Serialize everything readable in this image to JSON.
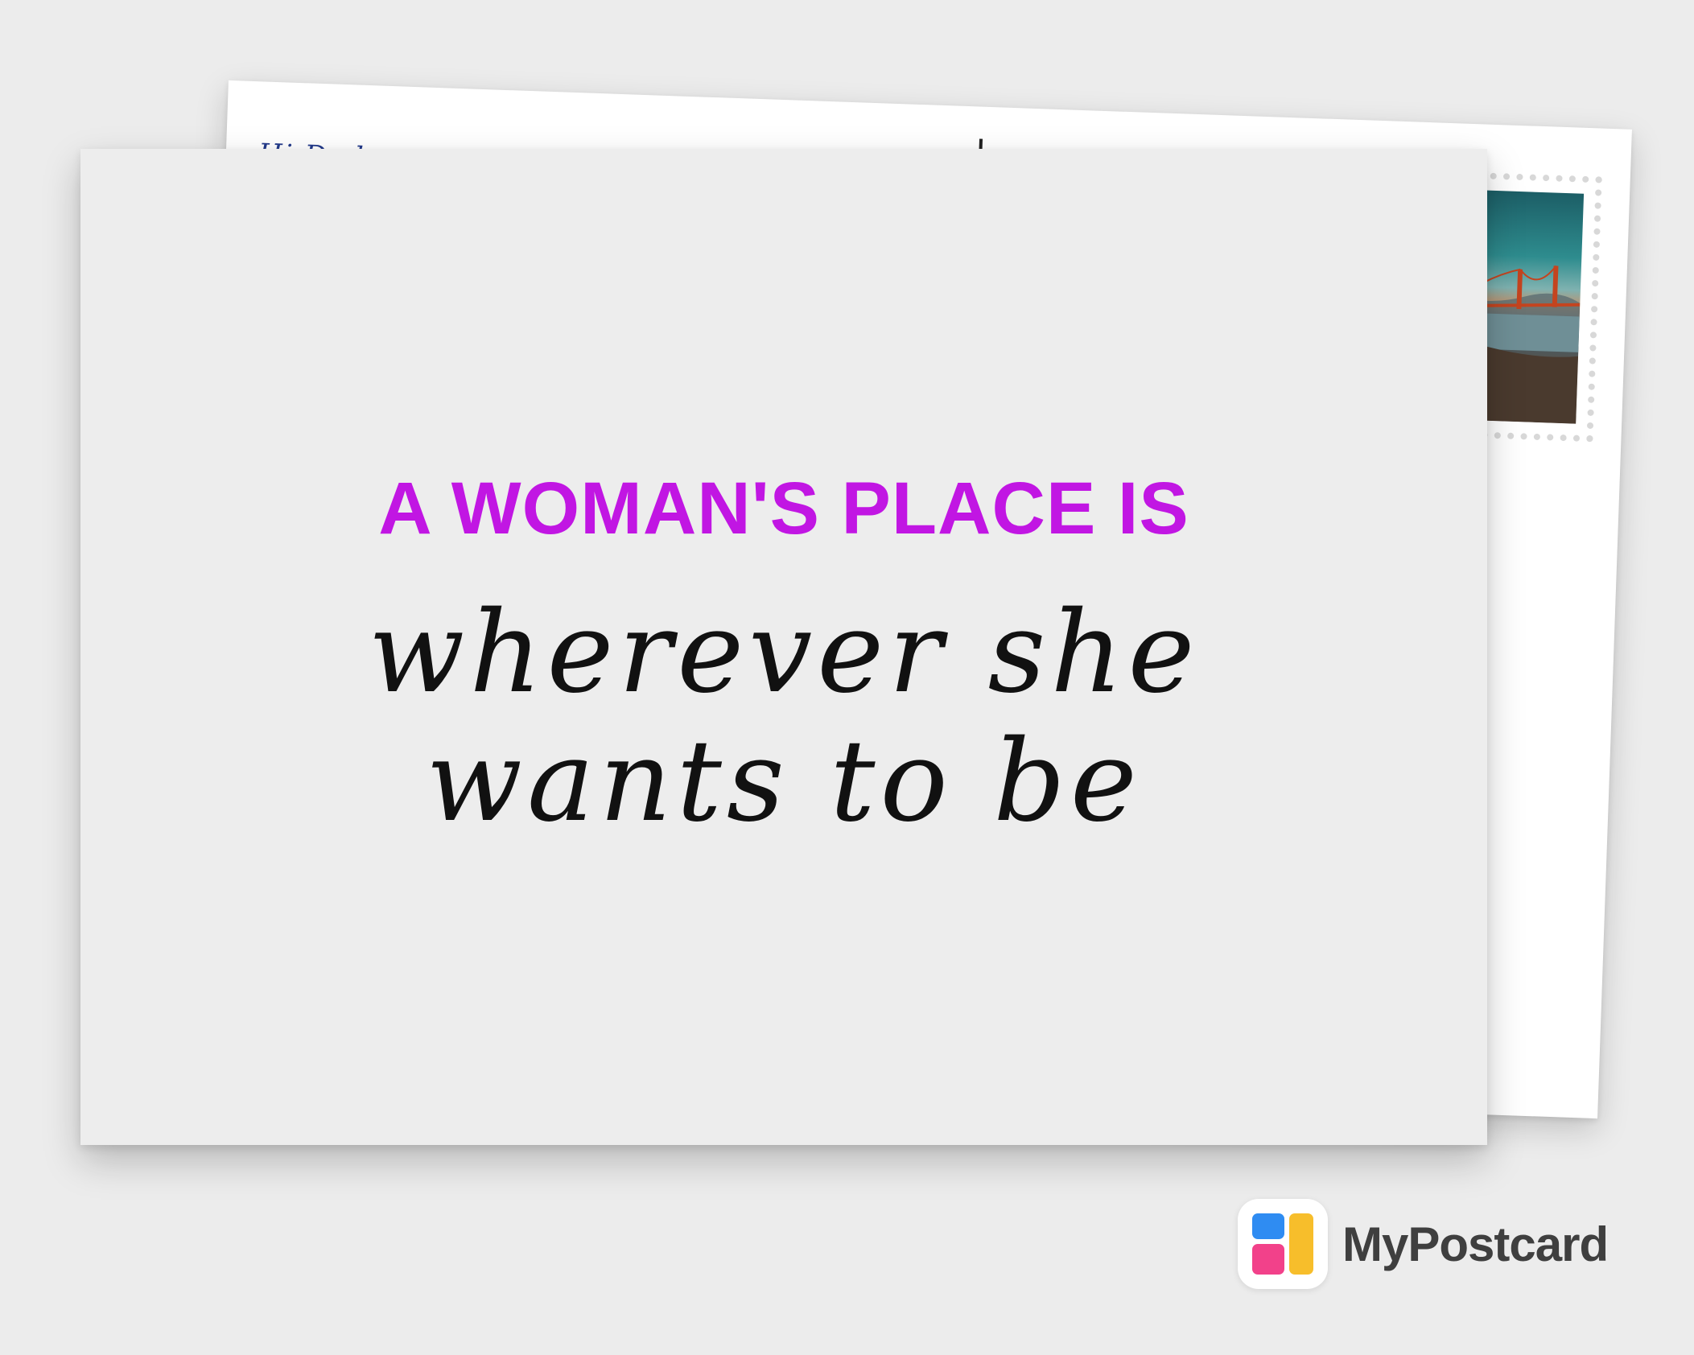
{
  "back_card": {
    "greeting": "Hi Dad,"
  },
  "front_card": {
    "headline": "A WOMAN'S PLACE IS",
    "script_line_1": "wherever she",
    "script_line_2": "wants to be"
  },
  "stamp": {
    "photo_subject": "golden-gate-bridge-photo"
  },
  "brand": {
    "name": "MyPostcard",
    "icon": "mypostcard-logo-icon",
    "colors": {
      "blue": "#2f8cf2",
      "pink": "#f2418a",
      "yellow": "#f7be2b"
    }
  },
  "colors": {
    "headline": "#c116e3",
    "script": "#111111",
    "background": "#ececec",
    "front_card": "#ededed"
  }
}
